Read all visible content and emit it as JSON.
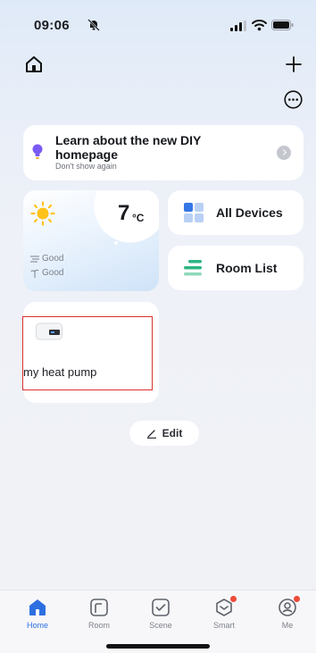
{
  "status": {
    "time": "09:06"
  },
  "banner": {
    "title": "Learn about the new DIY homepage",
    "subtitle": "Don't show again"
  },
  "weather": {
    "temperature": "7",
    "unit": "°C",
    "air_quality": "Good",
    "humidity": "Good"
  },
  "tiles": {
    "devices_label": "All Devices",
    "rooms_label": "Room List"
  },
  "device": {
    "name": "my heat pump"
  },
  "edit_label": "Edit",
  "tabs": [
    {
      "label": "Home",
      "icon": "home-icon",
      "active": true
    },
    {
      "label": "Room",
      "icon": "room-icon",
      "active": false
    },
    {
      "label": "Scene",
      "icon": "scene-icon",
      "active": false
    },
    {
      "label": "Smart",
      "icon": "smart-icon",
      "active": false,
      "badge": true
    },
    {
      "label": "Me",
      "icon": "profile-icon",
      "active": false,
      "badge": true
    }
  ],
  "colors": {
    "accent": "#2e6fe0",
    "highlight": "#d9322e",
    "badge": "#ee4a3a",
    "bulb": "#7a5af5",
    "sun": "#ffc21a"
  }
}
